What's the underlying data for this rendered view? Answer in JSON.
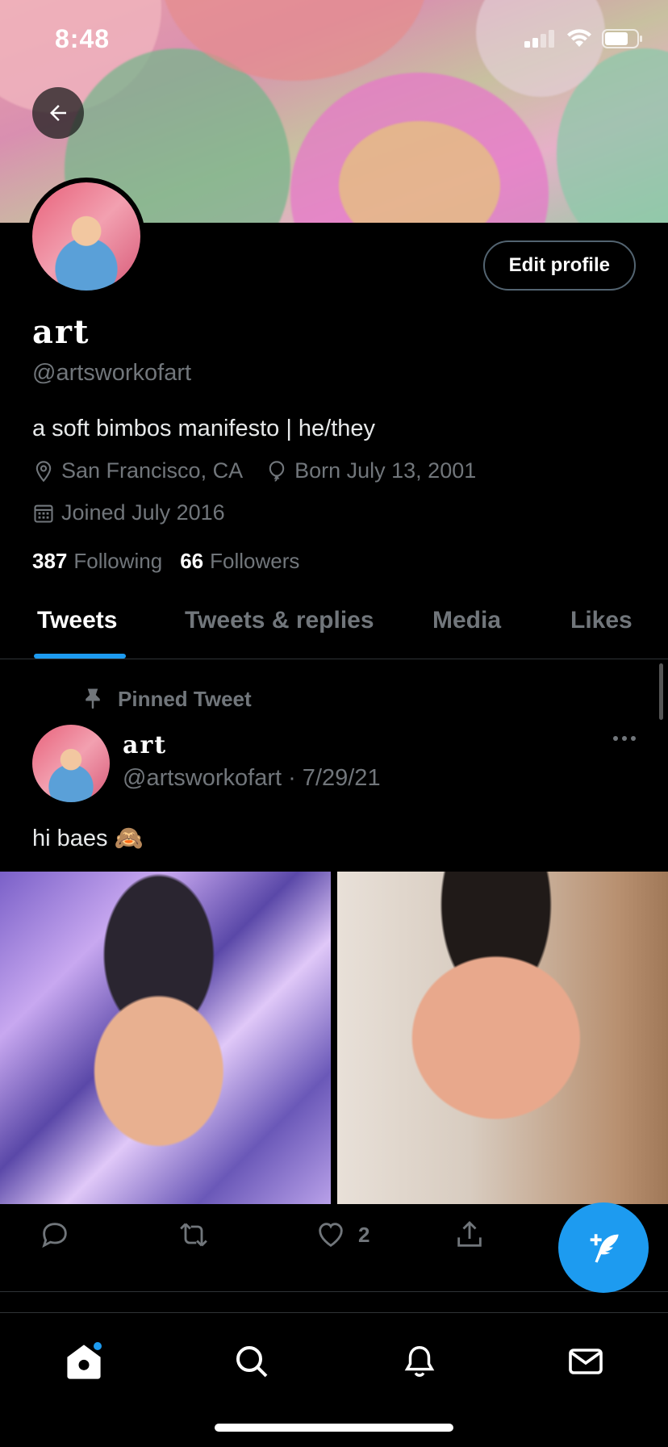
{
  "status_bar": {
    "time": "8:48"
  },
  "profile": {
    "name": "art",
    "handle": "@artsworkofart",
    "bio": "a soft bimbos manifesto | he/they",
    "location": "San Francisco, CA",
    "birthday": "Born July 13, 2001",
    "joined": "Joined July 2016",
    "following_count": "387",
    "following_label": "Following",
    "followers_count": "66",
    "followers_label": "Followers",
    "edit_button": "Edit profile"
  },
  "tabs": [
    {
      "label": "Tweets",
      "active": true
    },
    {
      "label": "Tweets & replies",
      "active": false
    },
    {
      "label": "Media",
      "active": false
    },
    {
      "label": "Likes",
      "active": false
    }
  ],
  "pinned_tweet": {
    "pinned_label": "Pinned Tweet",
    "author_name": "art",
    "author_handle_date": "@artsworkofart · 7/29/21",
    "text": "hi baes 🙈",
    "like_count": "2"
  },
  "colors": {
    "accent": "#1d9bf0",
    "muted": "#71767b",
    "background": "#000000"
  },
  "icons": {
    "back": "arrow-left-icon",
    "location": "location-pin-icon",
    "birthday": "balloon-icon",
    "joined": "calendar-icon",
    "pin": "pin-icon",
    "more": "more-horizontal-icon",
    "reply": "reply-icon",
    "retweet": "retweet-icon",
    "like": "heart-icon",
    "share": "share-icon",
    "compose": "compose-tweet-icon",
    "nav_home": "home-icon",
    "nav_search": "search-icon",
    "nav_notifications": "bell-icon",
    "nav_messages": "mail-icon"
  }
}
